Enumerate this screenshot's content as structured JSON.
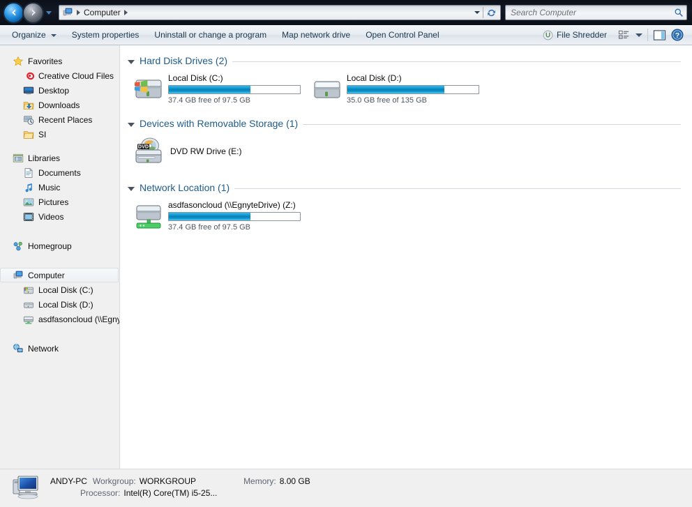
{
  "titlebar": {
    "back_label": "Back",
    "forward_label": "Forward",
    "history_dropdown_label": "Recent pages",
    "breadcrumb_icon": "computer-icon",
    "breadcrumb": "Computer",
    "address_dropdown_label": "Previous locations",
    "refresh_label": "Refresh"
  },
  "search": {
    "placeholder": "Search Computer",
    "value": "",
    "icon": "search-icon"
  },
  "commandbar": {
    "organize": "Organize",
    "system_properties": "System properties",
    "uninstall": "Uninstall or change a program",
    "map_network_drive": "Map network drive",
    "open_control_panel": "Open Control Panel",
    "file_shredder": "File Shredder",
    "views_label": "Change your view",
    "preview_label": "Show the preview pane",
    "help_label": "Get help"
  },
  "sidebar": {
    "groups": [
      {
        "name": "Favorites",
        "icon": "star-icon",
        "items": [
          {
            "label": "Creative Cloud Files",
            "icon": "creative-cloud-icon"
          },
          {
            "label": "Desktop",
            "icon": "desktop-icon"
          },
          {
            "label": "Downloads",
            "icon": "downloads-folder-icon"
          },
          {
            "label": "Recent Places",
            "icon": "recent-places-icon"
          },
          {
            "label": "SI",
            "icon": "folder-icon"
          }
        ]
      },
      {
        "name": "Libraries",
        "icon": "libraries-icon",
        "items": [
          {
            "label": "Documents",
            "icon": "documents-library-icon"
          },
          {
            "label": "Music",
            "icon": "music-library-icon"
          },
          {
            "label": "Pictures",
            "icon": "pictures-library-icon"
          },
          {
            "label": "Videos",
            "icon": "videos-library-icon"
          }
        ]
      },
      {
        "name": "Homegroup",
        "icon": "homegroup-icon",
        "items": []
      },
      {
        "name": "Computer",
        "icon": "computer-icon",
        "selected": true,
        "items": [
          {
            "label": "Local Disk (C:)",
            "icon": "system-drive-icon"
          },
          {
            "label": "Local Disk (D:)",
            "icon": "hard-drive-icon"
          },
          {
            "label": "asdfasoncloud (\\\\Egny",
            "icon": "network-drive-icon"
          }
        ]
      },
      {
        "name": "Network",
        "icon": "network-icon",
        "items": []
      }
    ]
  },
  "main": {
    "groups": [
      {
        "title": "Hard Disk Drives (2)",
        "expanded": true,
        "items": [
          {
            "name": "Local Disk (C:)",
            "icon": "system-drive-icon",
            "capacity_text": "37.4 GB free of 97.5 GB",
            "free_gb": 37.4,
            "total_gb": 97.5,
            "used_percent": 62,
            "bar_color": "#0b7fb5"
          },
          {
            "name": "Local Disk (D:)",
            "icon": "hard-drive-icon",
            "capacity_text": "35.0 GB free of 135 GB",
            "free_gb": 35.0,
            "total_gb": 135,
            "used_percent": 74,
            "bar_color": "#0b7fb5"
          }
        ]
      },
      {
        "title": "Devices with Removable Storage (1)",
        "expanded": true,
        "items": [
          {
            "name": "DVD RW Drive (E:)",
            "icon": "dvd-drive-icon",
            "capacity_text": "",
            "used_percent": null
          }
        ]
      },
      {
        "title": "Network Location (1)",
        "expanded": true,
        "items": [
          {
            "name": "asdfasoncloud (\\\\EgnyteDrive) (Z:)",
            "icon": "network-drive-icon",
            "capacity_text": "37.4 GB free of 97.5 GB",
            "free_gb": 37.4,
            "total_gb": 97.5,
            "used_percent": 62,
            "bar_color": "#0b7fb5"
          }
        ]
      }
    ]
  },
  "statusbar": {
    "icon": "computer-large-icon",
    "computer_name": "ANDY-PC",
    "workgroup_label": "Workgroup:",
    "workgroup_value": "WORKGROUP",
    "memory_label": "Memory:",
    "memory_value": "8.00 GB",
    "processor_label": "Processor:",
    "processor_value": "Intel(R) Core(TM) i5-25..."
  }
}
